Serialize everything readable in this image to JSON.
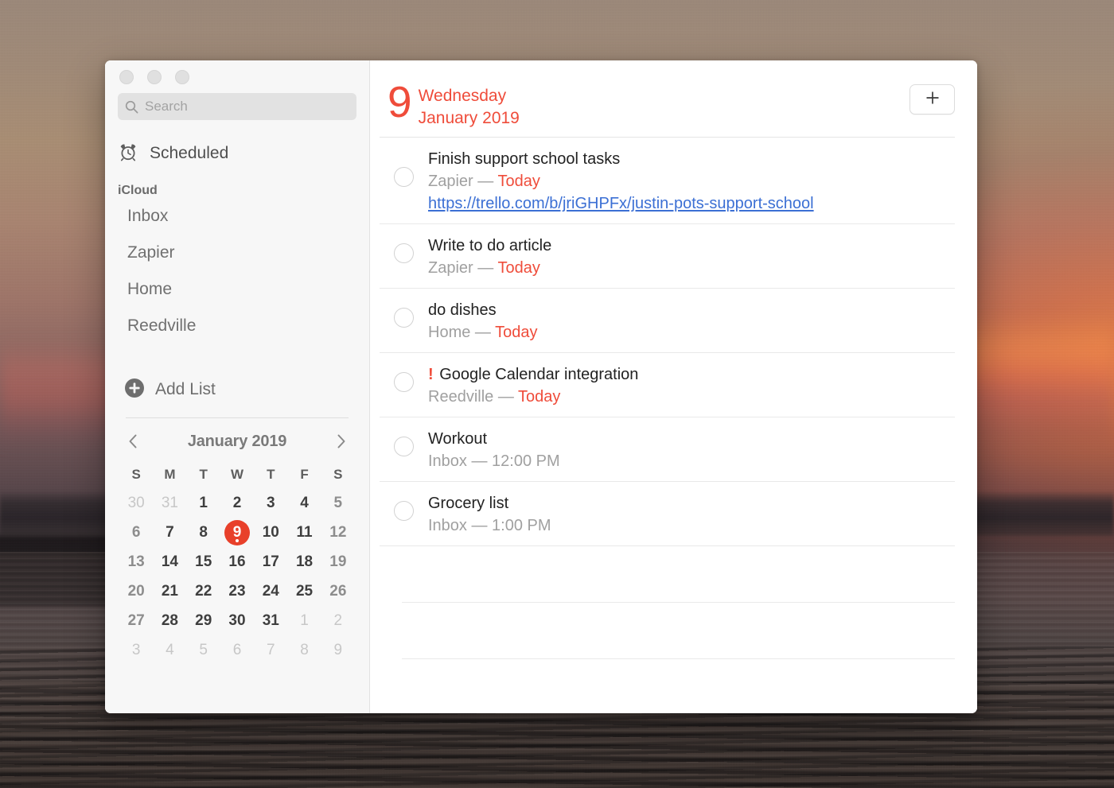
{
  "window": {
    "traffic_lights": [
      "close",
      "minimize",
      "zoom"
    ]
  },
  "sidebar": {
    "search": {
      "placeholder": "Search",
      "value": "",
      "icon": "search-icon"
    },
    "smart_list": {
      "label": "Scheduled",
      "icon": "alarm-clock-icon"
    },
    "group_title": "iCloud",
    "lists": [
      {
        "label": "Inbox"
      },
      {
        "label": "Zapier"
      },
      {
        "label": "Home"
      },
      {
        "label": "Reedville"
      }
    ],
    "add_list": {
      "label": "Add List",
      "icon": "plus-circle-icon"
    }
  },
  "calendar": {
    "title": "January 2019",
    "prev_icon": "chevron-left-icon",
    "next_icon": "chevron-right-icon",
    "day_headers": [
      "S",
      "M",
      "T",
      "W",
      "T",
      "F",
      "S"
    ],
    "weeks": [
      [
        {
          "d": "30",
          "other": true,
          "weekend": true
        },
        {
          "d": "31",
          "other": true,
          "weekend": false
        },
        {
          "d": "1",
          "other": false,
          "weekend": false
        },
        {
          "d": "2",
          "other": false,
          "weekend": false
        },
        {
          "d": "3",
          "other": false,
          "weekend": false
        },
        {
          "d": "4",
          "other": false,
          "weekend": false
        },
        {
          "d": "5",
          "other": false,
          "weekend": true
        }
      ],
      [
        {
          "d": "6",
          "other": false,
          "weekend": true
        },
        {
          "d": "7",
          "other": false,
          "weekend": false
        },
        {
          "d": "8",
          "other": false,
          "weekend": false
        },
        {
          "d": "9",
          "other": false,
          "weekend": false,
          "today": true,
          "has_event": true
        },
        {
          "d": "10",
          "other": false,
          "weekend": false
        },
        {
          "d": "11",
          "other": false,
          "weekend": false
        },
        {
          "d": "12",
          "other": false,
          "weekend": true
        }
      ],
      [
        {
          "d": "13",
          "other": false,
          "weekend": true
        },
        {
          "d": "14",
          "other": false,
          "weekend": false
        },
        {
          "d": "15",
          "other": false,
          "weekend": false
        },
        {
          "d": "16",
          "other": false,
          "weekend": false
        },
        {
          "d": "17",
          "other": false,
          "weekend": false
        },
        {
          "d": "18",
          "other": false,
          "weekend": false
        },
        {
          "d": "19",
          "other": false,
          "weekend": true
        }
      ],
      [
        {
          "d": "20",
          "other": false,
          "weekend": true
        },
        {
          "d": "21",
          "other": false,
          "weekend": false
        },
        {
          "d": "22",
          "other": false,
          "weekend": false
        },
        {
          "d": "23",
          "other": false,
          "weekend": false
        },
        {
          "d": "24",
          "other": false,
          "weekend": false
        },
        {
          "d": "25",
          "other": false,
          "weekend": false
        },
        {
          "d": "26",
          "other": false,
          "weekend": true
        }
      ],
      [
        {
          "d": "27",
          "other": false,
          "weekend": true
        },
        {
          "d": "28",
          "other": false,
          "weekend": false
        },
        {
          "d": "29",
          "other": false,
          "weekend": false
        },
        {
          "d": "30",
          "other": false,
          "weekend": false
        },
        {
          "d": "31",
          "other": false,
          "weekend": false
        },
        {
          "d": "1",
          "other": true,
          "weekend": false
        },
        {
          "d": "2",
          "other": true,
          "weekend": true
        }
      ],
      [
        {
          "d": "3",
          "other": true,
          "weekend": true
        },
        {
          "d": "4",
          "other": true,
          "weekend": false
        },
        {
          "d": "5",
          "other": true,
          "weekend": false
        },
        {
          "d": "6",
          "other": true,
          "weekend": false
        },
        {
          "d": "7",
          "other": true,
          "weekend": false
        },
        {
          "d": "8",
          "other": true,
          "weekend": false
        },
        {
          "d": "9",
          "other": true,
          "weekend": true
        }
      ]
    ]
  },
  "main": {
    "header": {
      "day_number": "9",
      "weekday": "Wednesday",
      "month_year": "January 2019",
      "add_button_icon": "plus-icon",
      "add_button_label": "+"
    },
    "tasks": [
      {
        "title": "Finish support school tasks",
        "priority": "",
        "list": "Zapier",
        "separator": "—",
        "due": "Today",
        "link": "https://trello.com/b/jriGHPFx/justin-pots-support-school",
        "completed": false
      },
      {
        "title": "Write to do article",
        "priority": "",
        "list": "Zapier",
        "separator": "—",
        "due": "Today",
        "link": "",
        "completed": false
      },
      {
        "title": "do dishes",
        "priority": "",
        "list": "Home",
        "separator": "—",
        "due": "Today",
        "link": "",
        "completed": false
      },
      {
        "title": "Google Calendar integration",
        "priority": "!",
        "list": "Reedville",
        "separator": "—",
        "due": "Today",
        "link": "",
        "completed": false
      },
      {
        "title": "Workout",
        "priority": "",
        "list": "Inbox",
        "separator": "—",
        "due": "12:00 PM",
        "due_is_time": true,
        "link": "",
        "completed": false
      },
      {
        "title": "Grocery list",
        "priority": "",
        "list": "Inbox",
        "separator": "—",
        "due": "1:00 PM",
        "due_is_time": true,
        "link": "",
        "completed": false
      }
    ],
    "empty_rows": 4
  },
  "colors": {
    "accent_red": "#ef4c3a",
    "today_pill": "#e8402a",
    "link_blue": "#3b6fd4",
    "sidebar_bg": "#f7f7f7",
    "meta_gray": "#a0a0a0"
  }
}
